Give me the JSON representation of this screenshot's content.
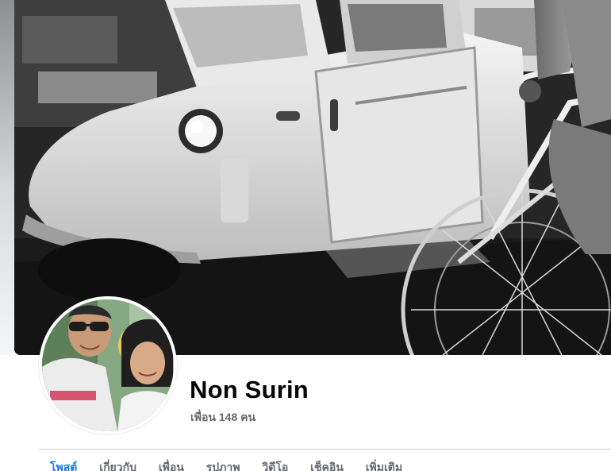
{
  "profile": {
    "name": "Non Surin",
    "friends_label": "เพื่อน 148 คน"
  },
  "tabs": [
    {
      "label": "โพสต์",
      "active": true
    },
    {
      "label": "เกี่ยวกับ",
      "active": false
    },
    {
      "label": "เพื่อน",
      "active": false
    },
    {
      "label": "รูปภาพ",
      "active": false
    },
    {
      "label": "วิดีโอ",
      "active": false
    },
    {
      "label": "เช็คอิน",
      "active": false
    },
    {
      "label": "เพิ่มเติม",
      "active": false
    }
  ],
  "colors": {
    "name_text": "#050505",
    "secondary_text": "#65676b",
    "active_tab": "#1877f2",
    "divider": "#ced0d4"
  }
}
